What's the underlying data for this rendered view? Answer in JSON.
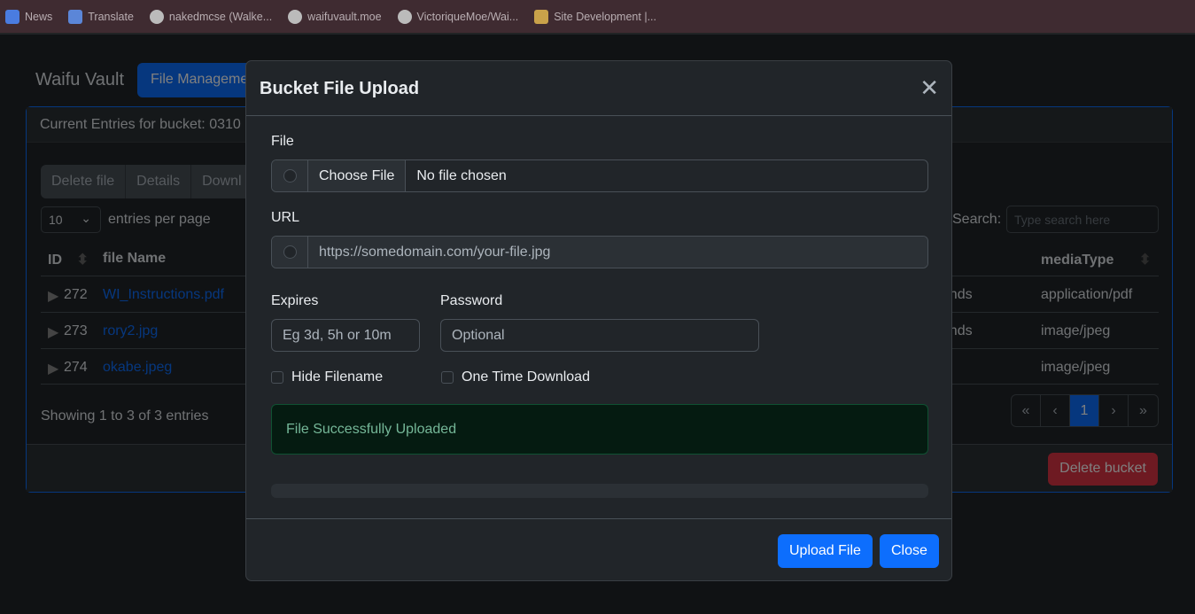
{
  "bookmarks": [
    {
      "label": "News",
      "icon": "google-news-icon"
    },
    {
      "label": "Translate",
      "icon": "google-translate-icon"
    },
    {
      "label": "nakedmcse (Walke...",
      "icon": "github-icon"
    },
    {
      "label": "waifuvault.moe",
      "icon": "github-icon"
    },
    {
      "label": "VictoriqueMoe/Wai...",
      "icon": "github-icon"
    },
    {
      "label": "Site Development |...",
      "icon": "trello-icon"
    }
  ],
  "app": {
    "brand": "Waifu Vault",
    "nav_active": "File Manageme"
  },
  "card": {
    "header": "Current Entries for bucket: 0310",
    "toolbar": [
      "Delete file",
      "Details",
      "Downl"
    ],
    "page_size": "10",
    "entries_per_page": "entries per page",
    "search_label": "Search:",
    "search_placeholder": "Type search here",
    "columns": {
      "id": "ID",
      "file_name": "file Name",
      "media_type": "mediaType"
    },
    "rows": [
      {
        "id": "272",
        "file_name": "WI_Instructions.pdf",
        "partial": "econds",
        "media_type": "application/pdf"
      },
      {
        "id": "273",
        "file_name": "rory2.jpg",
        "partial": "econds",
        "media_type": "image/jpeg"
      },
      {
        "id": "274",
        "file_name": "okabe.jpeg",
        "partial": "",
        "media_type": "image/jpeg"
      }
    ],
    "showing": "Showing 1 to 3 of 3 entries",
    "pagination": [
      "«",
      "‹",
      "1",
      "›",
      "»"
    ],
    "delete_bucket": "Delete bucket"
  },
  "modal": {
    "title": "Bucket File Upload",
    "file_label": "File",
    "choose_file": "Choose File",
    "no_file": "No file chosen",
    "url_label": "URL",
    "url_placeholder": "https://somedomain.com/your-file.jpg",
    "expires_label": "Expires",
    "expires_placeholder": "Eg 3d, 5h or 10m",
    "password_label": "Password",
    "password_placeholder": "Optional",
    "hide_filename": "Hide Filename",
    "one_time": "One Time Download",
    "alert": "File Successfully Uploaded",
    "progress_percent": 0,
    "upload": "Upload File",
    "close": "Close"
  },
  "colors": {
    "primary": "#0d6efd",
    "danger": "#dc3545",
    "success_text": "#75b798",
    "bookmark_bar": "#3f2b31"
  }
}
